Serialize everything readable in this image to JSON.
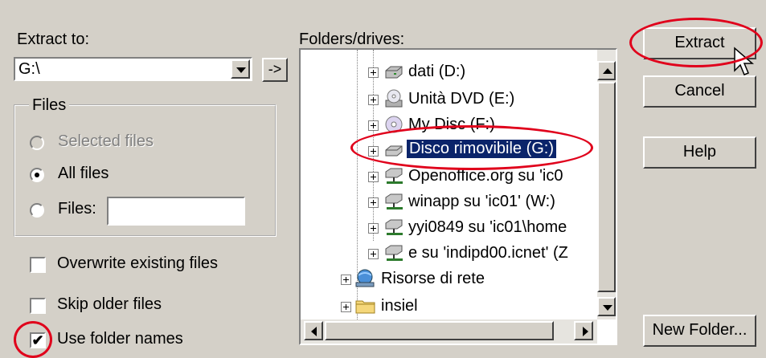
{
  "extract_to": {
    "label": "Extract to:",
    "value": "G:\\",
    "go_label": "->"
  },
  "files_group": {
    "title": "Files",
    "options": [
      "Selected files",
      "All files",
      "Files:"
    ],
    "selected": "All files",
    "files_input_value": ""
  },
  "checkboxes": {
    "overwrite": {
      "label": "Overwrite existing files",
      "checked": false
    },
    "skip_older": {
      "label": "Skip older files",
      "checked": false
    },
    "use_folder_names": {
      "label": "Use folder names",
      "checked": true
    }
  },
  "folders": {
    "label": "Folders/drives:",
    "items": [
      {
        "label": "dati (D:)",
        "icon": "hard-drive-icon"
      },
      {
        "label": "Unità DVD (E:)",
        "icon": "dvd-drive-icon"
      },
      {
        "label": "My Disc (F:)",
        "icon": "cd-drive-icon"
      },
      {
        "label": "Disco rimovibile (G:)",
        "icon": "removable-drive-icon",
        "selected": true
      },
      {
        "label": "Openoffice.org su 'ic0",
        "icon": "network-drive-icon"
      },
      {
        "label": "winapp su 'ic01' (W:)",
        "icon": "network-drive-icon"
      },
      {
        "label": "yyi0849 su 'ic01\\home",
        "icon": "network-drive-icon"
      },
      {
        "label": "e su 'indipd00.icnet' (Z",
        "icon": "network-drive-icon"
      },
      {
        "label": "Risorse di rete",
        "icon": "network-places-icon"
      },
      {
        "label": "insiel",
        "icon": "folder-icon"
      }
    ]
  },
  "buttons": {
    "extract": "Extract",
    "cancel": "Cancel",
    "help": "Help",
    "new_folder": "New Folder..."
  },
  "colors": {
    "annotation": "#e0001b",
    "selection": "#0a246a",
    "face": "#d4d0c8"
  }
}
